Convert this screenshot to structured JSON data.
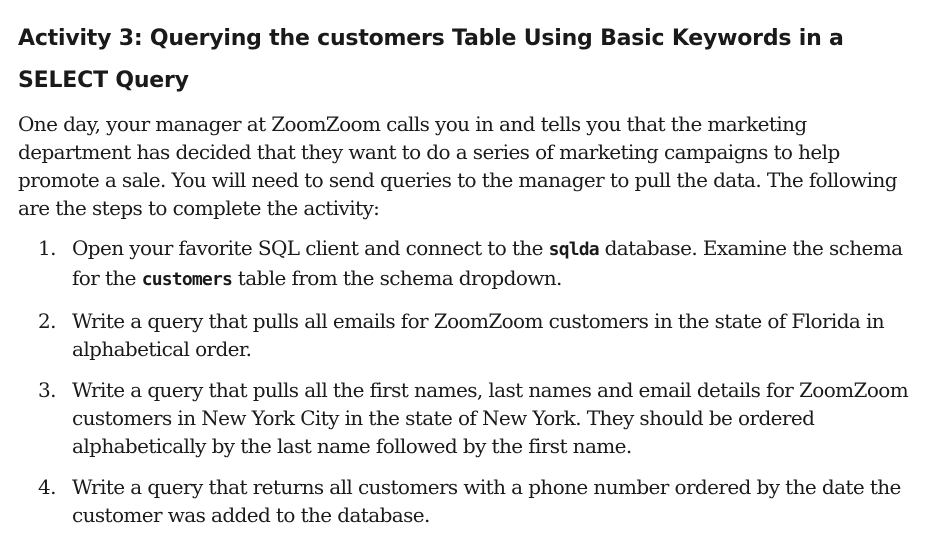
{
  "heading": "Activity 3: Querying the customers Table Using Basic Keywords in a SELECT Query",
  "intro": "One day, your manager at ZoomZoom calls you in and tells you that the marketing department has decided that they want to do a series of marketing campaigns to help promote a sale. You will need to send queries to the manager to pull the data. The following are the steps to complete the activity:",
  "steps": [
    {
      "number": "1.",
      "text_a": "Open your favorite SQL client and connect to the ",
      "code_a": "sqlda",
      "text_b": " database. Examine the schema for the ",
      "code_b": "customers",
      "text_c": " table from the schema dropdown."
    },
    {
      "number": "2.",
      "text": "Write a query that pulls all emails for ZoomZoom customers in the state of Florida in alphabetical order."
    },
    {
      "number": "3.",
      "text": "Write a query that pulls all the first names, last names and email details for ZoomZoom customers in New York City in the state of New York. They should be ordered alphabetically by the last name followed by the first name."
    },
    {
      "number": "4.",
      "text": "Write a query that returns all customers with a phone number ordered by the date the customer was added to the database."
    }
  ]
}
